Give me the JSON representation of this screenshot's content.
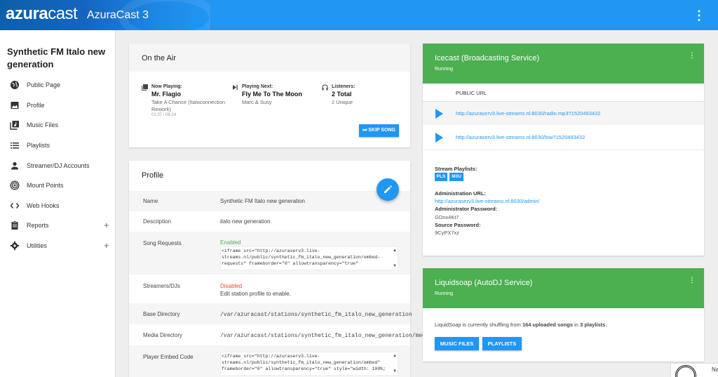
{
  "header": {
    "logo_bold": "azura",
    "logo_rest": "cast",
    "title": "AzuraCast 3",
    "menu_icon": "kebab-menu-icon"
  },
  "sidebar": {
    "station_name": "Synthetic FM Italo new generation",
    "items": [
      {
        "label": "Public Page",
        "icon": "globe-icon"
      },
      {
        "label": "Profile",
        "icon": "image-icon"
      },
      {
        "label": "Music Files",
        "icon": "library-music-icon"
      },
      {
        "label": "Playlists",
        "icon": "list-icon"
      },
      {
        "label": "Streamer/DJ Accounts",
        "icon": "person-icon"
      },
      {
        "label": "Mount Points",
        "icon": "broadcast-icon"
      },
      {
        "label": "Web Hooks",
        "icon": "code-icon"
      },
      {
        "label": "Reports",
        "icon": "clipboard-icon"
      },
      {
        "label": "Utilities",
        "icon": "gear-icon"
      }
    ]
  },
  "on_air": {
    "title": "On the Air",
    "now_playing": {
      "label": "Now Playing:",
      "title": "Mr. Flagio",
      "song": "Take A Chance (Italoconnection Rework)",
      "time": "01:37 / 06:24"
    },
    "playing_next": {
      "label": "Playing Next:",
      "title": "Fly Me To The Moon",
      "artist": "Marc & Susy"
    },
    "listeners": {
      "label": "Listeners:",
      "total": "2 Total",
      "unique": "2 Unique"
    },
    "skip_label": "⏭ SKIP SONG"
  },
  "profile": {
    "title": "Profile",
    "rows": {
      "name": {
        "key": "Name",
        "value": "Synthetic FM Italo new generation"
      },
      "description": {
        "key": "Description",
        "value": "italo new generation"
      },
      "song_requests": {
        "key": "Song Requests",
        "status": "Enabled",
        "code": "<iframe src=\"http://azuraserv3.live-streams.nl/public/synthetic_fm_italo_new_generation/embed-requests\" frameborder=\"0\" allowtransparency=\"true\""
      },
      "streamers": {
        "key": "Streamers/DJs",
        "status": "Disabled",
        "note": "Edit station profile to enable."
      },
      "base_dir": {
        "key": "Base Directory",
        "value": "/var/azuracast/stations/synthetic_fm_italo_new_generation"
      },
      "media_dir": {
        "key": "Media Directory",
        "value": "/var/azuracast/stations/synthetic_fm_italo_new_generation/media"
      },
      "player_embed": {
        "key": "Player Embed Code",
        "code": "<iframe src=\"http://azuraserv3.live-streams.nl/public/synthetic_fm_italo_new_generation/embed\" frameborder=\"0\" allowtransparency=\"true\" style=\"width: 100%;"
      }
    }
  },
  "icecast": {
    "title": "Icecast (Broadcasting Service)",
    "status": "Running",
    "public_url_header": "PUBLIC URL",
    "urls": [
      "http://azuraserv3.live-streams.nl:8030/radio.mp3?1520493432",
      "http://azuraserv3.live-streams.nl:8030/low?1520493432"
    ],
    "stream_playlists_label": "Stream Playlists:",
    "playlist_tags": [
      "PLS",
      "M3U"
    ],
    "admin_url_label": "Administration URL:",
    "admin_url": "http://azuraserv3.live-streams.nl:8030/admin/",
    "admin_pw_label": "Administrator Password:",
    "admin_pw": "GDnx4Kt7",
    "source_pw_label": "Source Password:",
    "source_pw": "9CyPX7xz"
  },
  "liquidsoap": {
    "title": "Liquidsoap (AutoDJ Service)",
    "status": "Running",
    "desc_prefix": "LiquidSoap is currently shuffling from ",
    "song_count": "164 uploaded songs",
    "desc_mid": " in ",
    "playlist_count": "3 playlists",
    "desc_suffix": ".",
    "music_files_label": "MUSIC FILES",
    "playlists_label": "PLAYLISTS"
  },
  "corner": {
    "text": "Na"
  },
  "colors": {
    "primary": "#2196f3",
    "success": "#4caf50",
    "danger": "#f44336",
    "enabled": "#4caf50"
  }
}
